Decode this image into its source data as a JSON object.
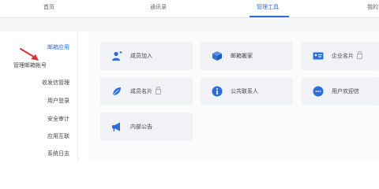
{
  "nav_tabs": [
    {
      "label": "首页"
    },
    {
      "label": "通讯录"
    },
    {
      "label": "管理工具"
    },
    {
      "label": "我的"
    }
  ],
  "sidebar": {
    "items": [
      {
        "label": "邮箱应用"
      },
      {
        "label": "管理邮箱帐号"
      },
      {
        "label": "收发信管理"
      },
      {
        "label": "用户登录"
      },
      {
        "label": "安全审计"
      },
      {
        "label": "应用互联"
      },
      {
        "label": "系统日志"
      }
    ]
  },
  "cards": [
    {
      "label": "成员加入"
    },
    {
      "label": "邮箱搬家"
    },
    {
      "label": "企业名片"
    },
    {
      "label": "成员名片"
    },
    {
      "label": "公共联系人"
    },
    {
      "label": "用户欢迎信"
    },
    {
      "label": "内部公告"
    }
  ],
  "colors": {
    "accent": "#2d6fd6",
    "annotation": "#e03131"
  }
}
